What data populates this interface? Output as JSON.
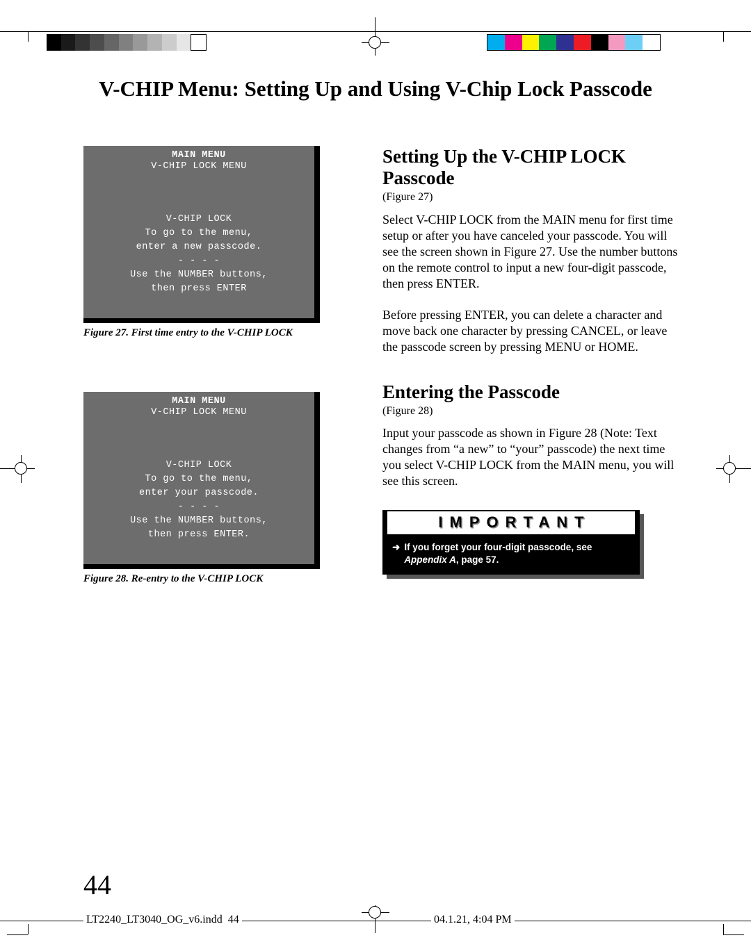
{
  "page_title": "V-CHIP Menu:  Setting Up and Using V-Chip Lock Passcode",
  "figure27": {
    "menu1": "MAIN MENU",
    "menu2": "V-CHIP LOCK MENU",
    "body": "V-CHIP LOCK\nTo go to the menu,\nenter a new passcode.\n- - - -\nUse the NUMBER buttons,\nthen press ENTER",
    "caption": "Figure 27.  First time entry to the V-CHIP LOCK"
  },
  "figure28": {
    "menu1": "MAIN MENU",
    "menu2": "V-CHIP LOCK MENU",
    "body": "V-CHIP LOCK\nTo go to the menu,\nenter your passcode.\n- - - -\nUse the NUMBER buttons,\nthen press ENTER.",
    "caption": "Figure 28. Re-entry to the V-CHIP LOCK"
  },
  "section1": {
    "heading": "Setting Up the V-CHIP LOCK Passcode",
    "figref": "(Figure 27)",
    "para1": "Select V-CHIP LOCK from the MAIN menu for first time setup or after you have canceled your passcode. You will see the screen shown in Figure 27.  Use the number buttons on the remote control to input a new four-digit passcode, then press ENTER.",
    "para2": "Before pressing ENTER, you can delete a character and move back one character by pressing CANCEL, or leave the passcode screen by pressing  MENU or HOME."
  },
  "section2": {
    "heading": "Entering the Passcode",
    "figref": "(Figure 28)",
    "para1": "Input your passcode as shown in Figure 28 (Note: Text changes from “a new” to “your” passcode) the next time you select V-CHIP LOCK from the MAIN menu, you will see this screen."
  },
  "important": {
    "heading": "IMPORTANT",
    "text_pre": "If you forget your four-digit passcode, see ",
    "text_em": "Appendix A",
    "text_post": ", page 57."
  },
  "page_number": "44",
  "footer": {
    "filename": "LT2240_LT3040_OG_v6.indd",
    "page_overlay": "44",
    "datetime": "04.1.21, 4:04 PM"
  }
}
